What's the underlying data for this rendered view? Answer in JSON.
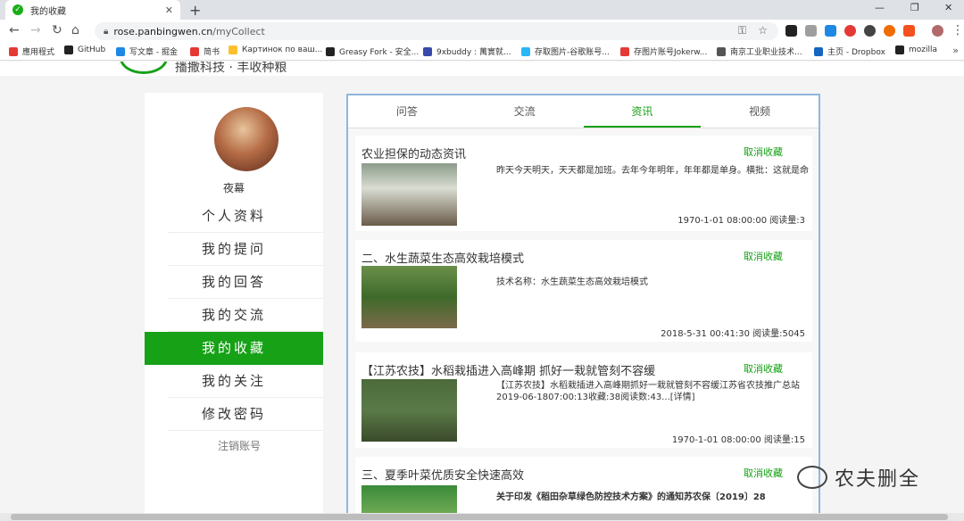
{
  "browser": {
    "tab_title": "我的收藏",
    "tab_close": "✕",
    "new_tab": "+",
    "url_host": "rose.panbingwen.cn",
    "url_path": "/myCollect",
    "win_min": "—",
    "win_max": "❐",
    "win_close": "✕",
    "bookmarks": [
      {
        "label": "應用程式",
        "color": "#e53935"
      },
      {
        "label": "GitHub",
        "color": "#222222"
      },
      {
        "label": "写文章 - 掘金",
        "color": "#1e88e5"
      },
      {
        "label": "简书",
        "color": "#e53935"
      },
      {
        "label": "Картинок по ваш...",
        "color": "#fbc02d"
      },
      {
        "label": "Greasy Fork - 安全...",
        "color": "#222222"
      },
      {
        "label": "9xbuddy : 萬實就...",
        "color": "#3949ab"
      },
      {
        "label": "存取图片-谷歌账号...",
        "color": "#29b6f6"
      },
      {
        "label": "存图片账号Jokerw...",
        "color": "#e53935"
      },
      {
        "label": "南京工业职业技术...",
        "color": "#555555"
      },
      {
        "label": "主页 - Dropbox",
        "color": "#1565c0"
      },
      {
        "label": "mozilla",
        "color": "#222222"
      }
    ],
    "bookmarks_more": "»"
  },
  "site": {
    "slogan": "播撒科技 · 丰收种粮"
  },
  "sidebar": {
    "username": "夜幕",
    "menu": [
      {
        "label": "个人资料",
        "active": false
      },
      {
        "label": "我的提问",
        "active": false
      },
      {
        "label": "我的回答",
        "active": false
      },
      {
        "label": "我的交流",
        "active": false
      },
      {
        "label": "我的收藏",
        "active": true
      },
      {
        "label": "我的关注",
        "active": false
      },
      {
        "label": "修改密码",
        "active": false
      }
    ],
    "logout": "注销账号"
  },
  "panel": {
    "tabs": [
      {
        "label": "问答",
        "active": false
      },
      {
        "label": "交流",
        "active": false
      },
      {
        "label": "资讯",
        "active": true
      },
      {
        "label": "视频",
        "active": false
      }
    ],
    "items": [
      {
        "title": "农业担保的动态资讯",
        "action": "取消收藏",
        "snippet": [
          "昨天今天明天，天天都是加班。去年今年明年，年年都是单身。横批：这就是命"
        ],
        "date": "1970-1-01 08:00:00",
        "reads": "阅读量:3"
      },
      {
        "title": "二、水生蔬菜生态高效栽培模式",
        "action": "取消收藏",
        "snippet": [
          "技术名称：水生蔬菜生态高效栽培模式"
        ],
        "date": "2018-5-31 00:41:30",
        "reads": "阅读量:5045"
      },
      {
        "title": "【江苏农技】水稻栽插进入高峰期 抓好一栽就管刻不容缓",
        "action": "取消收藏",
        "snippet": [
          "【江苏农技】水稻栽插进入高峰期抓好一栽就管刻不容缓江苏省农技推广总站",
          "2019-06-1807:00:13收藏:38阅读数:43...[详情]"
        ],
        "date": "1970-1-01 08:00:00",
        "reads": "阅读量:15"
      },
      {
        "title": "三、夏季叶菜优质安全快速高效",
        "action": "取消收藏",
        "snippet": [
          "关于印发《稻田杂草绿色防控技术方案》的通知苏农保〔2019〕28"
        ],
        "date": "",
        "reads": ""
      }
    ]
  },
  "watermark": "农夫删全"
}
